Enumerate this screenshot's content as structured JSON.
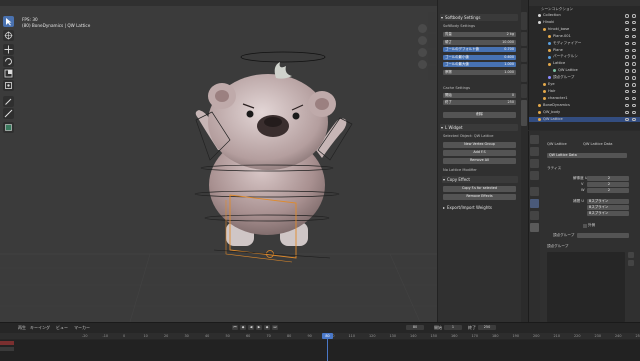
{
  "viewport": {
    "fps": "FPS: 30",
    "object_info": "(80) BoneDynamics | QW Lattice"
  },
  "npanel": {
    "softbody": {
      "header": "Softbody Settings",
      "sub_label": "SoftBody Settings",
      "rows": [
        {
          "label": "質量",
          "value": "2 kg"
        },
        {
          "label": "硬さ",
          "value": "10.000"
        },
        {
          "label": "ゴールのデフォルト値",
          "value": "0.700"
        },
        {
          "label": "ゴールの最小値",
          "value": "0.600"
        },
        {
          "label": "ゴールの最大値",
          "value": "1.000"
        },
        {
          "label": "摩擦",
          "value": "1.000"
        }
      ],
      "cache_label": "Cache Settings",
      "cache_rows": [
        {
          "label": "開始",
          "value": "0"
        },
        {
          "label": "終了",
          "value": "250"
        }
      ],
      "delete_button": "削除"
    },
    "widget": {
      "header": "L Widget",
      "selected": "Selected Object: QW Lattice",
      "buttons": [
        "New Vertex Group",
        "Add F.S",
        "Remove All"
      ],
      "no_modifier": "No Lattice Modifier",
      "copy_header": "Copy Effect",
      "copy_buttons": [
        "Copy F.s for selected",
        "Remove Effects"
      ],
      "export": "Export/Import Weights"
    },
    "tabs": [
      "アイテム",
      "ツール",
      "ビュー",
      "Create",
      "Edit",
      "QW"
    ]
  },
  "outliner": {
    "title": "シーンコレクション",
    "rows": [
      {
        "name": "Collection",
        "indent": 1
      },
      {
        "name": "Hinoki",
        "indent": 1
      },
      {
        "name": "hinoki_base",
        "indent": 2
      },
      {
        "name": "Plane.001",
        "indent": 3
      },
      {
        "name": "モディファイアー",
        "indent": 3
      },
      {
        "name": "Plane",
        "indent": 3
      },
      {
        "name": "パーティクルシ",
        "indent": 3
      },
      {
        "name": "Lattice",
        "indent": 3
      },
      {
        "name": "QW Lattice",
        "indent": 4
      },
      {
        "name": "頂点グループ",
        "indent": 3
      },
      {
        "name": "Eye",
        "indent": 2
      },
      {
        "name": "Hair",
        "indent": 2
      },
      {
        "name": "character1",
        "indent": 2
      },
      {
        "name": "BoneDynamics",
        "indent": 1
      },
      {
        "name": "QW_body",
        "indent": 1
      },
      {
        "name": "QW Lattice",
        "indent": 1,
        "selected": true
      }
    ]
  },
  "properties": {
    "breadcrumb_obj": "QW Lattice",
    "breadcrumb_data": "QW Lattice Data",
    "data_name": "QW Lattice Data",
    "lattice_header": "ラティス",
    "resolution_label": "解像度 U",
    "u": "2",
    "v_label": "V",
    "v": "2",
    "w_label": "W",
    "w": "2",
    "interp_label": "補間 U",
    "interp_u": "Bスプライン",
    "interp_v": "Bスプライン",
    "interp_w": "Bスプライン",
    "outside_label": "外側",
    "vgroup_label": "頂点グループ",
    "vgroup_header": "頂点グループ",
    "shapekey_header": "シェイプキー"
  },
  "timeline": {
    "menus": [
      "再生",
      "キーイング",
      "ビュー",
      "マーカー"
    ],
    "current_frame": "80",
    "start_label": "開始",
    "start": "1",
    "end_label": "終了",
    "end": "250",
    "ticks": [
      "-20",
      "-10",
      "0",
      "10",
      "20",
      "30",
      "40",
      "50",
      "60",
      "70",
      "80",
      "90",
      "100",
      "110",
      "120",
      "130",
      "140",
      "150",
      "160",
      "170",
      "180",
      "190",
      "200",
      "210",
      "220",
      "230",
      "240",
      "250",
      "260"
    ]
  }
}
